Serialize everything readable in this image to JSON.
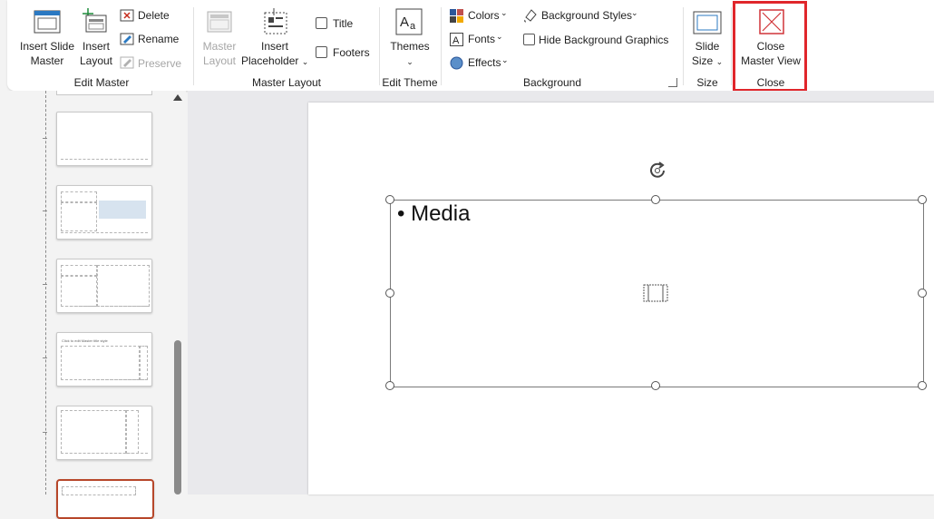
{
  "ribbon": {
    "edit_master": {
      "insert_slide_master": [
        "Insert Slide",
        "Master"
      ],
      "insert_layout": [
        "Insert",
        "Layout"
      ],
      "delete": "Delete",
      "rename": "Rename",
      "preserve": "Preserve",
      "group_label": "Edit Master"
    },
    "master_layout": {
      "master_layout_btn": [
        "Master",
        "Layout"
      ],
      "insert_placeholder": [
        "Insert",
        "Placeholder"
      ],
      "title": "Title",
      "footers": "Footers",
      "group_label": "Master Layout"
    },
    "edit_theme": {
      "themes": "Themes",
      "group_label": "Edit Theme"
    },
    "background": {
      "colors": "Colors",
      "fonts": "Fonts",
      "effects": "Effects",
      "background_styles": "Background Styles",
      "hide_background_graphics": "Hide Background Graphics",
      "group_label": "Background"
    },
    "size": {
      "slide_size": [
        "Slide",
        "Size"
      ],
      "group_label": "Size"
    },
    "close": {
      "close_master_view": [
        "Close",
        "Master View"
      ],
      "group_label": "Close"
    }
  },
  "slide": {
    "placeholder_text": "• Media"
  },
  "thumbnails": {
    "t4_title": "Click to edit Master title style"
  },
  "colors": {
    "highlight": "#e0262b",
    "accent_close": "#d13438"
  }
}
